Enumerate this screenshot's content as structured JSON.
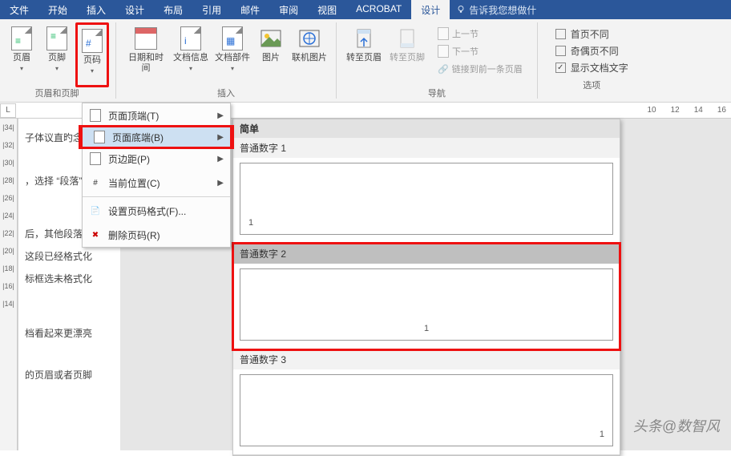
{
  "tabs": {
    "file": "文件",
    "home": "开始",
    "insert": "插入",
    "design": "设计",
    "layout": "布局",
    "references": "引用",
    "mail": "邮件",
    "review": "审阅",
    "view": "视图",
    "acrobat": "ACROBAT",
    "hf_design": "设计"
  },
  "tellme": "告诉我您想做什",
  "ribbon": {
    "header": "页眉",
    "footer": "页脚",
    "page_number": "页码",
    "datetime": "日期和时间",
    "docinfo": "文档信息",
    "docparts": "文档部件",
    "picture": "图片",
    "online_pic": "联机图片",
    "goto_header": "转至页眉",
    "goto_footer": "转至页脚",
    "prev": "上一节",
    "next": "下一节",
    "link_prev": "链接到前一条页眉",
    "diff_first": "首页不同",
    "diff_odd_even": "奇偶页不同",
    "show_doc_text": "显示文档文字"
  },
  "groups": {
    "hf": "页眉和页脚",
    "insert": "插入",
    "nav": "导航",
    "options": "选项"
  },
  "dropdown": {
    "top": "页面顶端(T)",
    "bottom": "页面底端(B)",
    "margins": "页边距(P)",
    "current": "当前位置(C)",
    "format": "设置页码格式(F)...",
    "remove": "删除页码(R)"
  },
  "gallery": {
    "section": "简单",
    "n1": "普通数字 1",
    "n2": "普通数字 2",
    "n3": "普通数字 3"
  },
  "ruler_L": "L",
  "ruler_right": [
    "10",
    "12",
    "14",
    "16"
  ],
  "ruler_v": [
    "|34|",
    "|32|",
    "|30|",
    "|28|",
    "|26|",
    "|24|",
    "|22|",
    "|20|",
    "|18|",
    "|16|",
    "|14|"
  ],
  "body_lines": [
    "子体议直旳念洧",
    "，选择 “段落”",
    "后，其他段落已",
    "这段已经格式化",
    "标框选未格式化",
    "档看起来更漂亮",
    "的页眉或者页脚"
  ],
  "watermark": "头条@数智风"
}
